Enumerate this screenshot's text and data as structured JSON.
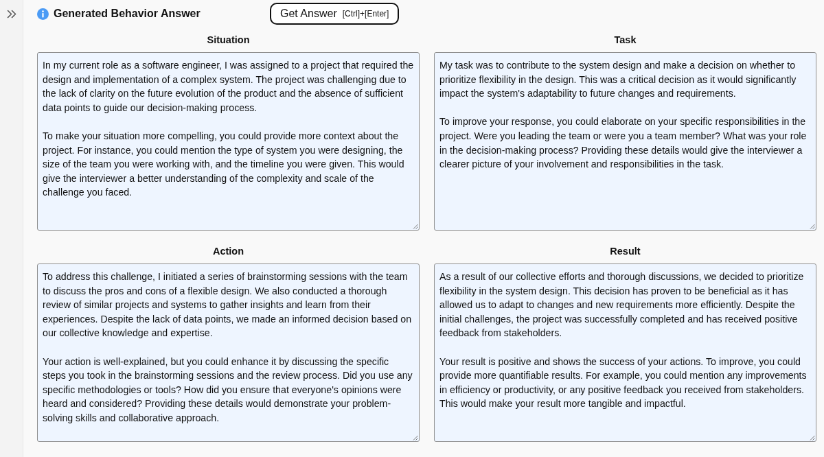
{
  "header": {
    "title": "Generated Behavior Answer",
    "button": {
      "label": "Get Answer",
      "shortcut": "[Ctrl]+[Enter]"
    }
  },
  "sections": [
    {
      "label": "Situation",
      "text": "In my current role as a software engineer, I was assigned to a project that required the design and implementation of a complex system. The project was challenging due to the lack of clarity on the future evolution of the product and the absence of sufficient data points to guide our decision-making process.\n\nTo make your situation more compelling, you could provide more context about the project. For instance, you could mention the type of system you were designing, the size of the team you were working with, and the timeline you were given. This would give the interviewer a better understanding of the complexity and scale of the challenge you faced."
    },
    {
      "label": "Task",
      "text": "My task was to contribute to the system design and make a decision on whether to prioritize flexibility in the design. This was a critical decision as it would significantly impact the system's adaptability to future changes and requirements.\n\nTo improve your response, you could elaborate on your specific responsibilities in the project. Were you leading the team or were you a team member? What was your role in the decision-making process? Providing these details would give the interviewer a clearer picture of your involvement and responsibilities in the task."
    },
    {
      "label": "Action",
      "text": "To address this challenge, I initiated a series of brainstorming sessions with the team to discuss the pros and cons of a flexible design. We also conducted a thorough review of similar projects and systems to gather insights and learn from their experiences. Despite the lack of data points, we made an informed decision based on our collective knowledge and expertise.\n\nYour action is well-explained, but you could enhance it by discussing the specific steps you took in the brainstorming sessions and the review process. Did you use any specific methodologies or tools? How did you ensure that everyone's opinions were heard and considered? Providing these details would demonstrate your problem-solving skills and collaborative approach."
    },
    {
      "label": "Result",
      "text": "As a result of our collective efforts and thorough discussions, we decided to prioritize flexibility in the system design. This decision has proven to be beneficial as it has allowed us to adapt to changes and new requirements more efficiently. Despite the initial challenges, the project was successfully completed and has received positive feedback from stakeholders.\n\nYour result is positive and shows the success of your actions. To improve, you could provide more quantifiable results. For example, you could mention any improvements in efficiency or productivity, or any positive feedback you received from stakeholders. This would make your result more tangible and impactful."
    }
  ]
}
